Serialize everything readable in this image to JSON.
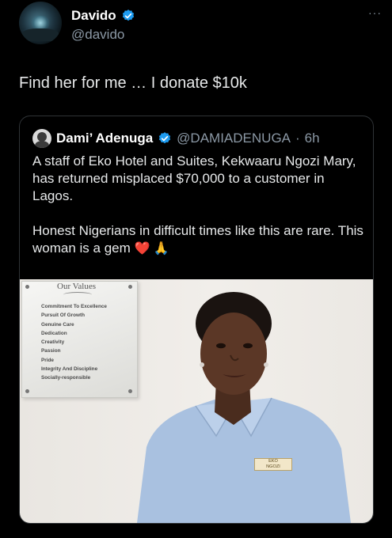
{
  "tweet": {
    "author_name": "Davido",
    "author_handle": "@davido",
    "more_icon": "···",
    "text": "Find her for me … I donate $10k",
    "verified_color": "#1d9bf0"
  },
  "quoted": {
    "author_name": "Dami’ Adenuga",
    "author_handle": "@DAMIADENUGA",
    "separator": "·",
    "time": "6h",
    "text_line1": "A staff of Eko Hotel and Suites, Kekwaaru Ngozi Mary, has returned misplaced $70,000 to a customer in Lagos.",
    "text_line2": "Honest Nigerians in difficult times like this are rare. This woman is a gem",
    "emojis": "❤️ 🙏",
    "photo": {
      "plaque_title": "Our Values",
      "plaque_items": [
        "Commitment To Excellence",
        "Pursuit Of Growth",
        "Genuine Care",
        "Dedication",
        "Creativity",
        "Passion",
        "Pride",
        "Integrity And Discipline",
        "Socially-responsible"
      ],
      "name_tag": "NGOZI",
      "name_tag_logo": "EKO"
    }
  }
}
